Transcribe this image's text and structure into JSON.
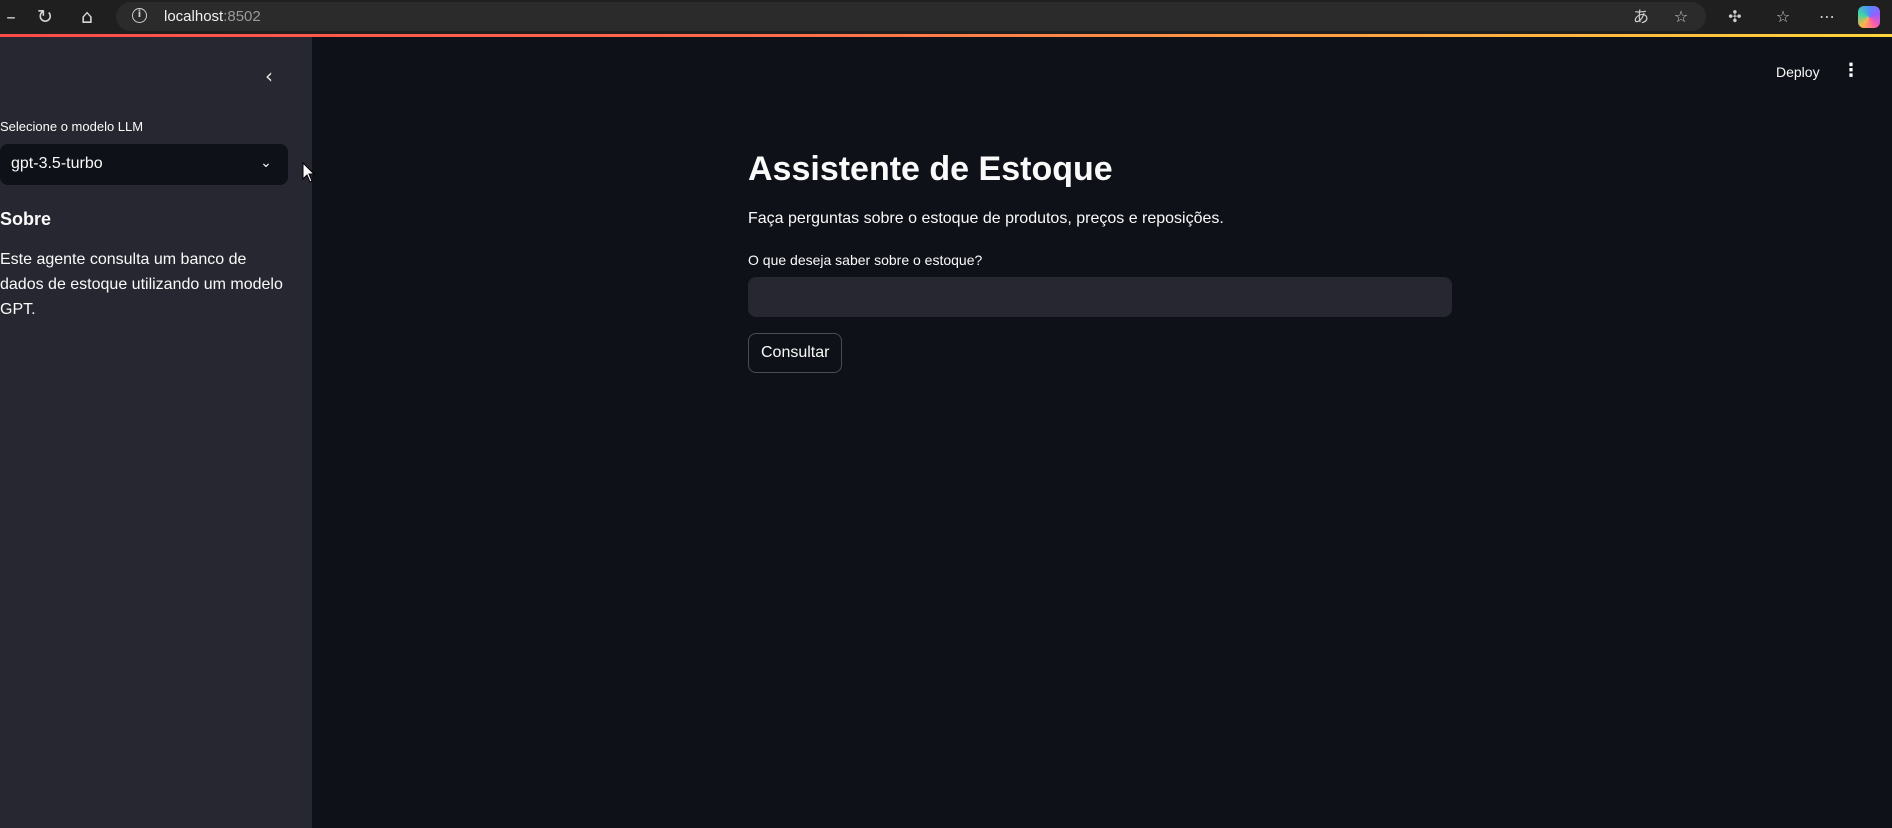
{
  "browser": {
    "url_host": "localhost",
    "url_port": ":8502",
    "accent_color": "#ff4b4b"
  },
  "icons": {
    "back": "arrow-left-icon",
    "reload": "reload-icon",
    "home": "home-icon",
    "info": "info-icon",
    "translate": "translate-icon",
    "favorite": "star-icon",
    "extensions": "puzzle-icon",
    "favorites_list": "favorites-icon",
    "menu": "more-icon",
    "copilot": "copilot-icon",
    "collapse": "chevron-left-icon",
    "dropdown": "chevron-down-icon",
    "app_menu": "kebab-icon"
  },
  "sidebar": {
    "select_label": "Selecione o modelo LLM",
    "selected_model": "gpt-3.5-turbo",
    "about_title": "Sobre",
    "about_text": "Este agente consulta um banco de dados de estoque utilizando um modelo GPT."
  },
  "header": {
    "deploy_label": "Deploy"
  },
  "main": {
    "title": "Assistente de Estoque",
    "subtitle": "Faça perguntas sobre o estoque de produtos, preços e reposições.",
    "input_label": "O que deseja saber sobre o estoque?",
    "input_value": "",
    "button_label": "Consultar"
  },
  "colors": {
    "background": "#0e1117",
    "sidebar": "#262730",
    "input_bg": "#262730",
    "text": "#fafafa"
  }
}
